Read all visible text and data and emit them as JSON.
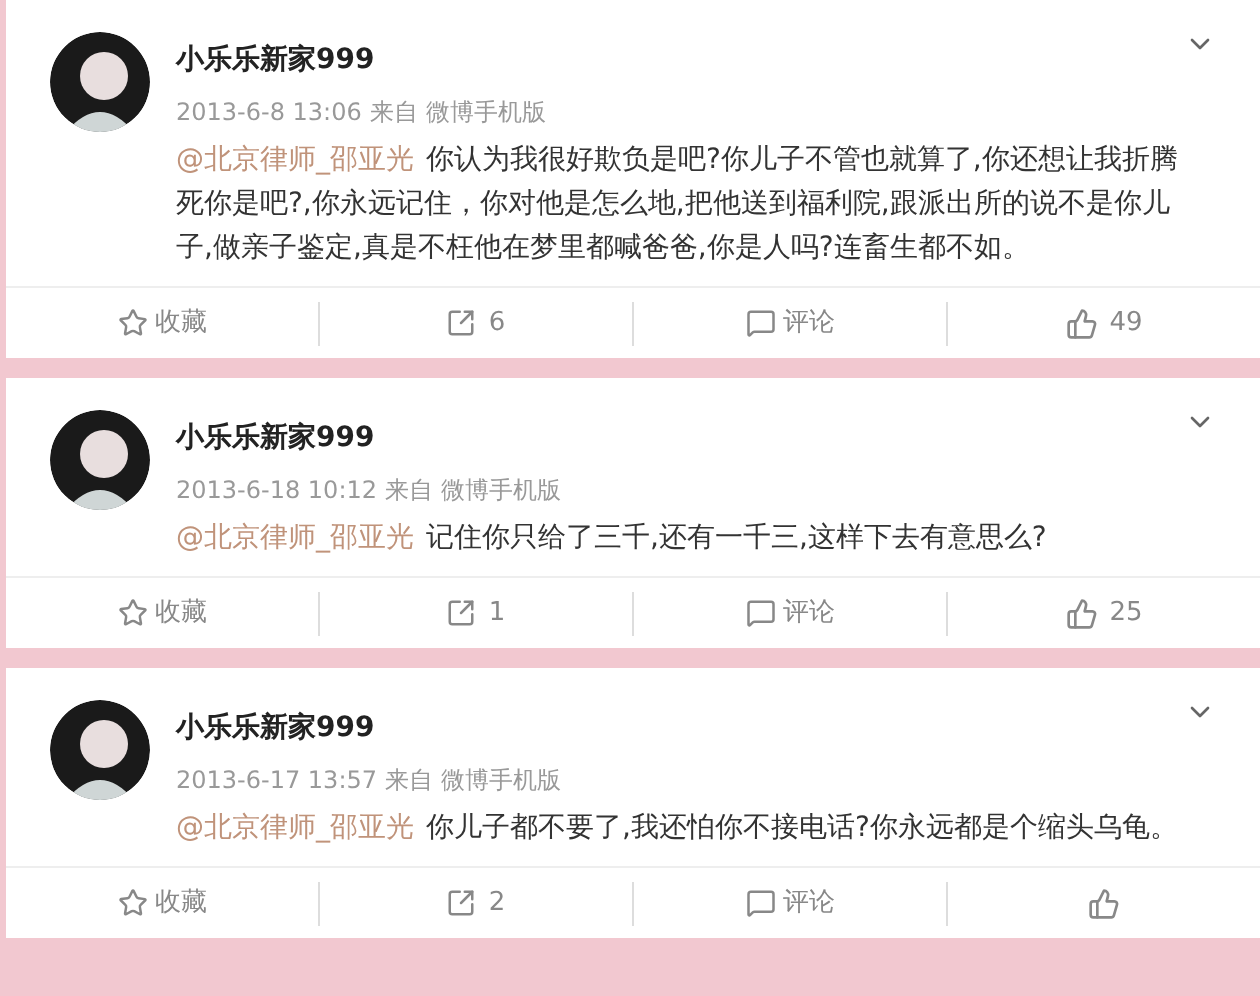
{
  "posts": [
    {
      "author": "小乐乐新家999",
      "time": "2013-6-8 13:06",
      "source_prefix": "来自",
      "source": "微博手机版",
      "mention": "@北京律师_邵亚光",
      "text": "你认为我很好欺负是吧?你儿子不管也就算了,你还想让我折腾死你是吧?,你永远记住，你对他是怎么地,把他送到福利院,跟派出所的说不是你儿子,做亲子鉴定,真是不枉他在梦里都喊爸爸,你是人吗?连畜生都不如。",
      "favorite": "收藏",
      "reposts": "6",
      "comment": "评论",
      "likes": "49"
    },
    {
      "author": "小乐乐新家999",
      "time": "2013-6-18 10:12",
      "source_prefix": "来自",
      "source": "微博手机版",
      "mention": "@北京律师_邵亚光",
      "text": "记住你只给了三千,还有一千三,这样下去有意思么?",
      "favorite": "收藏",
      "reposts": "1",
      "comment": "评论",
      "likes": "25"
    },
    {
      "author": "小乐乐新家999",
      "time": "2013-6-17 13:57",
      "source_prefix": "来自",
      "source": "微博手机版",
      "mention": "@北京律师_邵亚光",
      "text": "你儿子都不要了,我还怕你不接电话?你永远都是个缩头乌龟。",
      "favorite": "收藏",
      "reposts": "2",
      "comment": "评论"
    }
  ]
}
